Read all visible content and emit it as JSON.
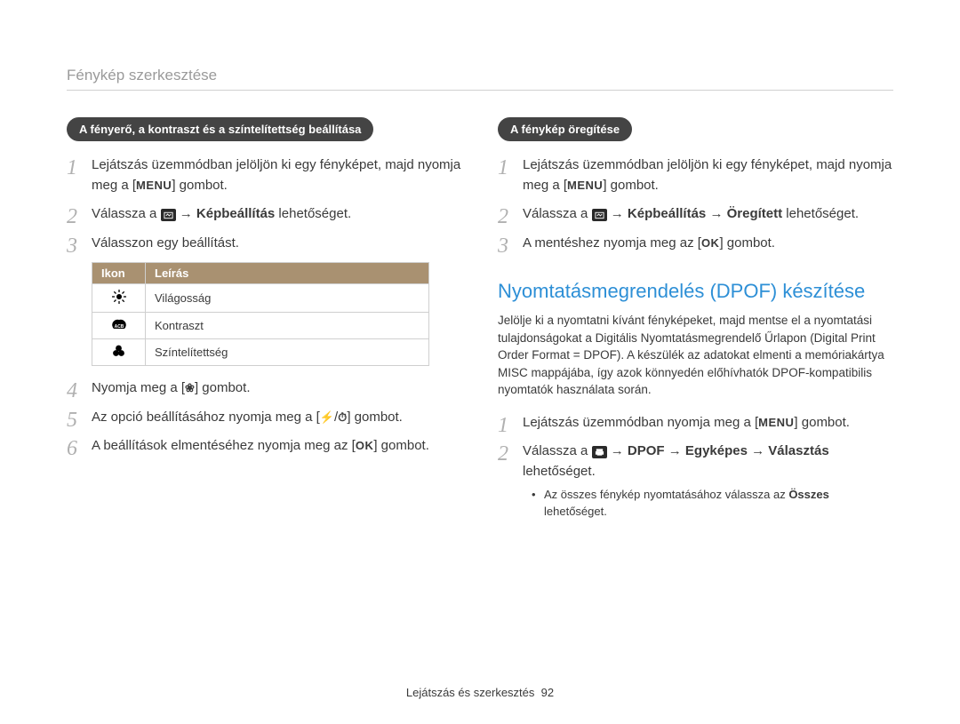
{
  "page_title": "Fénykép szerkesztése",
  "footer": {
    "section": "Lejátszás és szerkesztés",
    "page": "92"
  },
  "glyphs": {
    "menu": "MENU",
    "ok": "OK",
    "arrow": "→",
    "bracket_open": "[",
    "bracket_close": "]",
    "flower": "❀",
    "flash": "⚡",
    "timer": "⏱"
  },
  "left": {
    "pill": "A fényerő, a kontraszt és a színtelítettség beállítása",
    "steps": {
      "1": {
        "pre": "Lejátszás üzemmódban jelöljön ki egy fényképet, majd nyomja meg a [",
        "post": "] gombot."
      },
      "2": {
        "pre": "Válassza a ",
        "bold": "Képbeállítás",
        "post": " lehetőséget."
      },
      "3": "Válasszon egy beállítást.",
      "4": {
        "pre": "Nyomja meg a [",
        "post": "] gombot."
      },
      "5": {
        "pre": "Az opció beállításához nyomja meg a [",
        "post": "] gombot."
      },
      "6": {
        "pre": "A beállítások elmentéséhez nyomja meg az [",
        "post": "] gombot."
      }
    },
    "table": {
      "headers": {
        "icon": "Ikon",
        "desc": "Leírás"
      },
      "rows": [
        {
          "icon": "brightness",
          "desc": "Világosság"
        },
        {
          "icon": "contrast",
          "desc": "Kontraszt"
        },
        {
          "icon": "saturation",
          "desc": "Színtelítettség"
        }
      ]
    }
  },
  "right": {
    "pill": "A fénykép öregítése",
    "steps": {
      "1": {
        "pre": "Lejátszás üzemmódban jelöljön ki egy fényképet, majd nyomja meg a [",
        "post": "] gombot."
      },
      "2": {
        "pre": "Válassza a ",
        "b1": "Képbeállítás",
        "b2": "Öregített",
        "post": " lehetőséget."
      },
      "3": {
        "pre": "A mentéshez nyomja meg az [",
        "post": "] gombot."
      }
    },
    "dpof": {
      "heading": "Nyomtatásmegrendelés (DPOF) készítése",
      "para": "Jelölje ki a nyomtatni kívánt fényképeket, majd mentse el a nyomtatási tulajdonságokat a Digitális Nyomtatásmegrendelő Űrlapon (Digital Print Order Format = DPOF). A készülék az adatokat elmenti a memóriakártya MISC mappájába, így azok könnyedén előhívhatók DPOF-kompatibilis nyomtatók használata során.",
      "steps": {
        "1": {
          "pre": "Lejátszás üzemmódban nyomja meg a [",
          "post": "] gombot."
        },
        "2": {
          "pre": "Válassza a ",
          "b1": "DPOF",
          "b2": "Egyképes",
          "b3": "Választás",
          "post": "lehetőséget.",
          "bullet_pre": "Az összes fénykép nyomtatásához válassza az ",
          "bullet_bold": "Összes",
          "bullet_post": " lehetőséget."
        }
      }
    }
  }
}
